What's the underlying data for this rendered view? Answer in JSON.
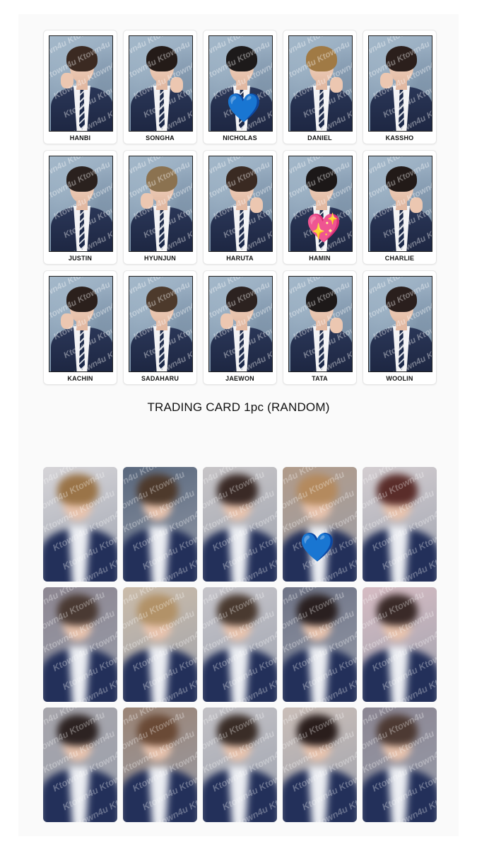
{
  "polaroids": [
    {
      "name": "HANBI",
      "hair": "#3b2a22"
    },
    {
      "name": "SONGHA",
      "hair": "#241b18"
    },
    {
      "name": "NICHOLAS",
      "hair": "#1d1a1a",
      "sticker": "💙"
    },
    {
      "name": "DANIEL",
      "hair": "#a07a45"
    },
    {
      "name": "KASSHO",
      "hair": "#2b1f1c"
    },
    {
      "name": "JUSTIN",
      "hair": "#2a211e"
    },
    {
      "name": "HYUNJUN",
      "hair": "#8b7250"
    },
    {
      "name": "HARUTA",
      "hair": "#3a2a22"
    },
    {
      "name": "HAMIN",
      "hair": "#1c1818",
      "sticker": "💖"
    },
    {
      "name": "CHARLIE",
      "hair": "#221a18"
    },
    {
      "name": "KACHIN",
      "hair": "#2b201c"
    },
    {
      "name": "SADAHARU",
      "hair": "#4d3a2c"
    },
    {
      "name": "JAEWON",
      "hair": "#2c2220"
    },
    {
      "name": "TATA",
      "hair": "#1d1919"
    },
    {
      "name": "WOOLIN",
      "hair": "#2a1f1d"
    }
  ],
  "watermark": "Ktown4u Ktown4u",
  "caption": "TRADING CARD 1pc (RANDOM)",
  "trading_cards": [
    {
      "bg": "#d9d7da",
      "hair": "#9a7448"
    },
    {
      "bg": "#55647a",
      "hair": "#4e3a2c"
    },
    {
      "bg": "#c9c6c8",
      "hair": "#3a2a26"
    },
    {
      "bg": "#b29a87",
      "hair": "#b48a5e",
      "sticker": "💙"
    },
    {
      "bg": "#d6cfd2",
      "hair": "#5a2d2a"
    },
    {
      "bg": "#8c8590",
      "hair": "#4a3a33"
    },
    {
      "bg": "#cdbda9",
      "hair": "#b29268"
    },
    {
      "bg": "#c8c6cb",
      "hair": "#4a3a30"
    },
    {
      "bg": "#6c7184",
      "hair": "#2a2020"
    },
    {
      "bg": "#d9bdc4",
      "hair": "#3a2a28"
    },
    {
      "bg": "#a7a5ab",
      "hair": "#2d2322"
    },
    {
      "bg": "#9a8272",
      "hair": "#6a4a36"
    },
    {
      "bg": "#c4c2c6",
      "hair": "#3a2d27"
    },
    {
      "bg": "#ccbfb8",
      "hair": "#2a1e1c"
    },
    {
      "bg": "#8a8491",
      "hair": "#4d3a33"
    }
  ]
}
